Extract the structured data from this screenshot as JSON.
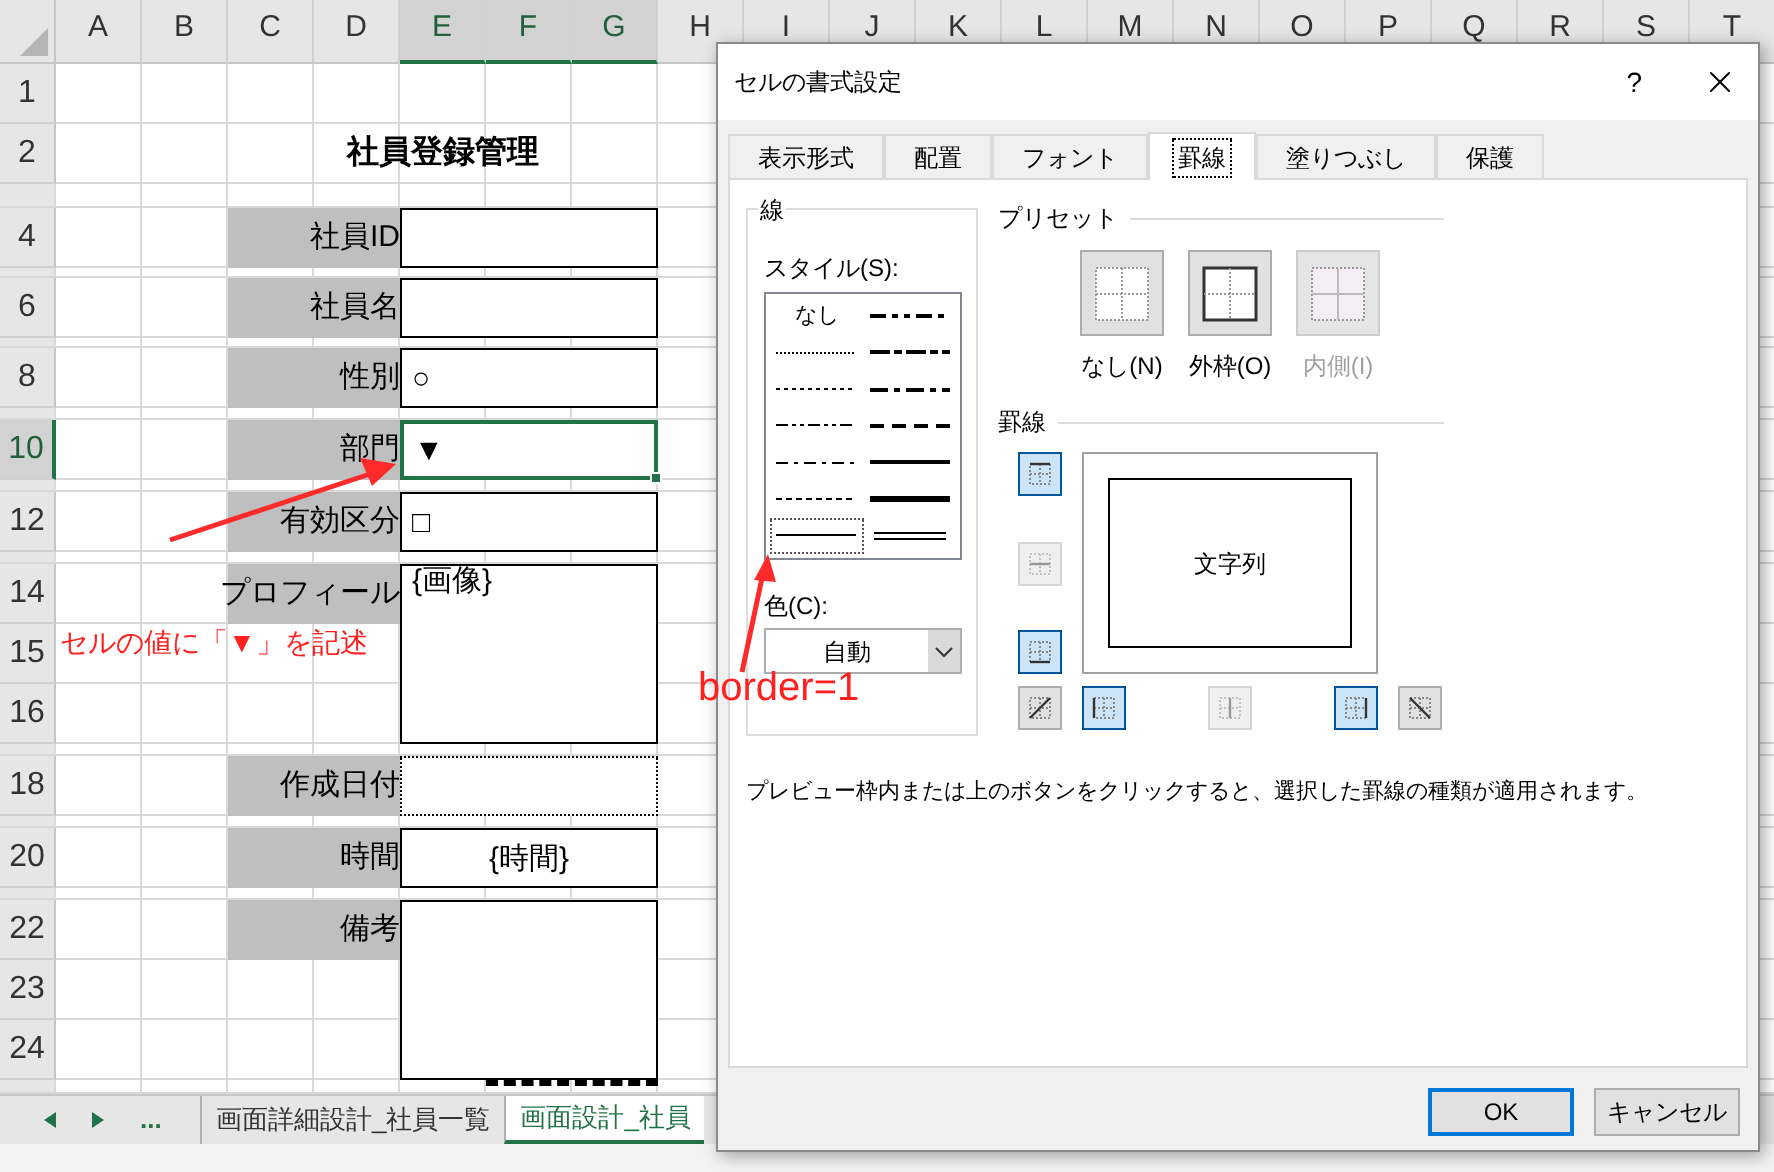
{
  "sheet": {
    "column_headers": [
      {
        "label": "A",
        "selected": false
      },
      {
        "label": "B",
        "selected": false
      },
      {
        "label": "C",
        "selected": false
      },
      {
        "label": "D",
        "selected": false
      },
      {
        "label": "E",
        "selected": true
      },
      {
        "label": "F",
        "selected": true
      },
      {
        "label": "G",
        "selected": true
      },
      {
        "label": "H",
        "selected": false
      },
      {
        "label": "I",
        "selected": false
      },
      {
        "label": "J",
        "selected": false
      },
      {
        "label": "K",
        "selected": false
      },
      {
        "label": "L",
        "selected": false
      },
      {
        "label": "M",
        "selected": false
      },
      {
        "label": "N",
        "selected": false
      },
      {
        "label": "O",
        "selected": false
      },
      {
        "label": "P",
        "selected": false
      },
      {
        "label": "Q",
        "selected": false
      },
      {
        "label": "R",
        "selected": false
      },
      {
        "label": "S",
        "selected": false
      },
      {
        "label": "T",
        "selected": false
      }
    ],
    "row_headers": [
      {
        "label": "1",
        "selected": false
      },
      {
        "label": "2",
        "selected": false
      },
      {
        "label": "4",
        "selected": false
      },
      {
        "label": "6",
        "selected": false
      },
      {
        "label": "8",
        "selected": false
      },
      {
        "label": "10",
        "selected": true
      },
      {
        "label": "12",
        "selected": false
      },
      {
        "label": "14",
        "selected": false
      },
      {
        "label": "15",
        "selected": false
      },
      {
        "label": "16",
        "selected": false
      },
      {
        "label": "18",
        "selected": false
      },
      {
        "label": "20",
        "selected": false
      },
      {
        "label": "22",
        "selected": false
      },
      {
        "label": "23",
        "selected": false
      },
      {
        "label": "24",
        "selected": false
      }
    ],
    "title": "社員登録管理",
    "fields": [
      {
        "label": "社員ID",
        "dotted": false,
        "selected": false
      },
      {
        "label": "社員名",
        "dotted": false,
        "selected": false
      },
      {
        "label": "性別",
        "value": "○",
        "dotted": false,
        "centered": false,
        "selected": false
      },
      {
        "label": "部門",
        "value": "▼",
        "dotted": false,
        "centered": false,
        "selected": true
      },
      {
        "label": "有効区分",
        "value": "□",
        "dotted": false,
        "centered": false,
        "selected": false
      },
      {
        "label": "プロフィール",
        "value": "{画像}",
        "dotted": false,
        "centered": false,
        "selected": false
      },
      {
        "label": "作成日付",
        "dotted": true,
        "selected": false
      },
      {
        "label": "時間",
        "value": "{時間}",
        "dotted": false,
        "centered": true,
        "selected": false
      },
      {
        "label": "備考",
        "dotted": false,
        "selected": false
      }
    ],
    "sheet_tabs": [
      {
        "label": "画面詳細設計_社員一覧",
        "selected": false
      },
      {
        "label": "画面設計_社員",
        "selected": true
      }
    ],
    "tab_overflow": "..."
  },
  "annotations": [
    {
      "text": "セルの値に「▼」を記述"
    },
    {
      "text": "border=1"
    }
  ],
  "dialog": {
    "title": "セルの書式設定",
    "help": "?",
    "tabs": [
      {
        "label": "表示形式",
        "selected": false
      },
      {
        "label": "配置",
        "selected": false
      },
      {
        "label": "フォント",
        "selected": false
      },
      {
        "label": "罫線",
        "selected": true
      },
      {
        "label": "塗りつぶし",
        "selected": false
      },
      {
        "label": "保護",
        "selected": false
      }
    ],
    "line_group": {
      "title": "線",
      "style_label": "スタイル(S):",
      "styles": [
        {
          "kind": "none",
          "label": "なし",
          "selected": false
        },
        {
          "kind": "hair",
          "selected": false
        },
        {
          "kind": "dotted",
          "selected": false
        },
        {
          "kind": "dashdotdot",
          "selected": false
        },
        {
          "kind": "dashdot",
          "selected": false
        },
        {
          "kind": "dashed",
          "selected": false
        },
        {
          "kind": "thin",
          "selected": true
        },
        {
          "kind": "medium_dashdotdot",
          "selected": false
        },
        {
          "kind": "slant_dashdot",
          "selected": false
        },
        {
          "kind": "medium_dashdot",
          "selected": false
        },
        {
          "kind": "medium_dashed",
          "selected": false
        },
        {
          "kind": "medium",
          "selected": false
        },
        {
          "kind": "thick",
          "selected": false
        },
        {
          "kind": "double",
          "selected": false
        }
      ],
      "color_label": "色(C):",
      "color_value": "自動"
    },
    "presets": {
      "title": "プリセット",
      "items": [
        {
          "kind": "none",
          "label": "なし(N)",
          "disabled": false
        },
        {
          "kind": "outline",
          "label": "外枠(O)",
          "disabled": false
        },
        {
          "kind": "inside",
          "label": "内側(I)",
          "disabled": true
        }
      ]
    },
    "borders": {
      "title": "罫線",
      "preview_text": "文字列",
      "buttons": [
        {
          "kind": "top",
          "on": true,
          "disabled": false
        },
        {
          "kind": "middle_h",
          "on": false,
          "disabled": true
        },
        {
          "kind": "bottom",
          "on": true,
          "disabled": false
        },
        {
          "kind": "diag_up",
          "on": false,
          "disabled": false
        },
        {
          "kind": "left",
          "on": true,
          "disabled": false
        },
        {
          "kind": "middle_v",
          "on": false,
          "disabled": true
        },
        {
          "kind": "right",
          "on": true,
          "disabled": false
        },
        {
          "kind": "diag_down",
          "on": false,
          "disabled": false
        }
      ]
    },
    "hint": "プレビュー枠内または上のボタンをクリックすると、選択した罫線の種類が適用されます。",
    "buttons": [
      {
        "label": "OK",
        "default": true
      },
      {
        "label": "キャンセル",
        "default": false
      }
    ]
  }
}
